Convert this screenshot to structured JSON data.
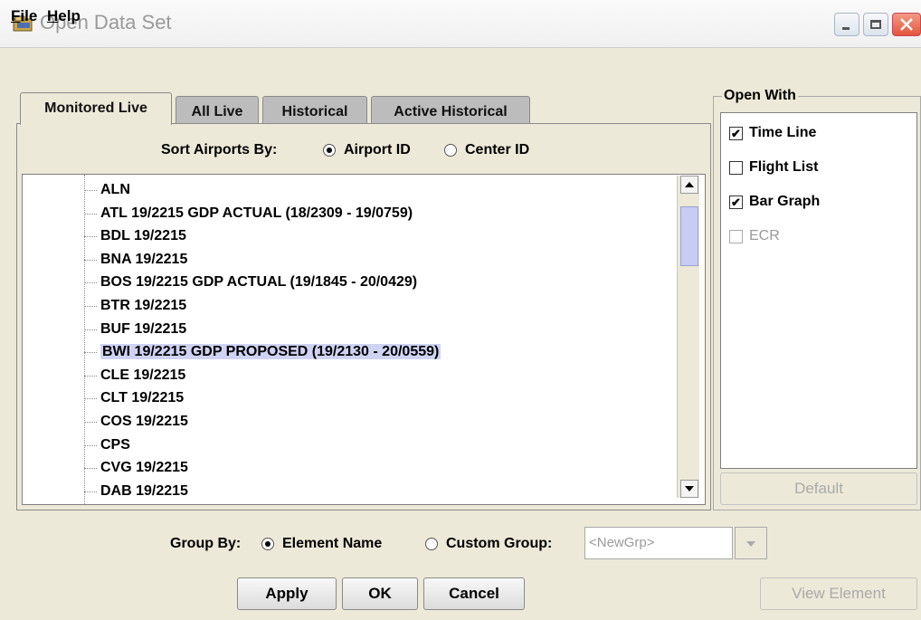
{
  "window": {
    "title": "Open Data Set"
  },
  "menu": {
    "file": "File",
    "file_mnemonic": "F",
    "help": "Help",
    "help_mnemonic": "H"
  },
  "tabs": [
    {
      "label": "Monitored Live",
      "active": true
    },
    {
      "label": "All Live",
      "active": false
    },
    {
      "label": "Historical",
      "active": false
    },
    {
      "label": "Active Historical",
      "active": false
    }
  ],
  "sort": {
    "label": "Sort Airports By:",
    "options": [
      {
        "label": "Airport ID",
        "selected": true
      },
      {
        "label": "Center ID",
        "selected": false
      }
    ]
  },
  "airports": [
    {
      "text": "ALN",
      "selected": false
    },
    {
      "text": "ATL 19/2215 GDP ACTUAL (18/2309 - 19/0759)",
      "selected": false
    },
    {
      "text": "BDL 19/2215",
      "selected": false
    },
    {
      "text": "BNA 19/2215",
      "selected": false
    },
    {
      "text": "BOS 19/2215 GDP ACTUAL (19/1845 - 20/0429)",
      "selected": false
    },
    {
      "text": "BTR 19/2215",
      "selected": false
    },
    {
      "text": "BUF 19/2215",
      "selected": false
    },
    {
      "text": "BWI 19/2215 GDP PROPOSED (19/2130 - 20/0559)",
      "selected": true
    },
    {
      "text": "CLE 19/2215",
      "selected": false
    },
    {
      "text": "CLT 19/2215",
      "selected": false
    },
    {
      "text": "COS 19/2215",
      "selected": false
    },
    {
      "text": "CPS",
      "selected": false
    },
    {
      "text": "CVG 19/2215",
      "selected": false
    },
    {
      "text": "DAB 19/2215",
      "selected": false
    }
  ],
  "scroll": {
    "position": 0.05
  },
  "open_with": {
    "title": "Open With",
    "options": [
      {
        "label": "Time Line",
        "checked": true,
        "enabled": true
      },
      {
        "label": "Flight List",
        "checked": false,
        "enabled": true
      },
      {
        "label": "Bar Graph",
        "checked": true,
        "enabled": true
      },
      {
        "label": "ECR",
        "checked": false,
        "enabled": false
      }
    ],
    "default_label": "Default"
  },
  "group_by": {
    "label": "Group By:",
    "element_name": "Element Name",
    "custom_group": "Custom Group:",
    "element_selected": true,
    "combo_value": "<NewGrp>"
  },
  "buttons": {
    "apply": "Apply",
    "ok": "OK",
    "cancel": "Cancel",
    "view_element": "View Element"
  },
  "colors": {
    "selection": "#cfd3f3",
    "close_button": "#e3563c",
    "background": "#ece9d8"
  }
}
